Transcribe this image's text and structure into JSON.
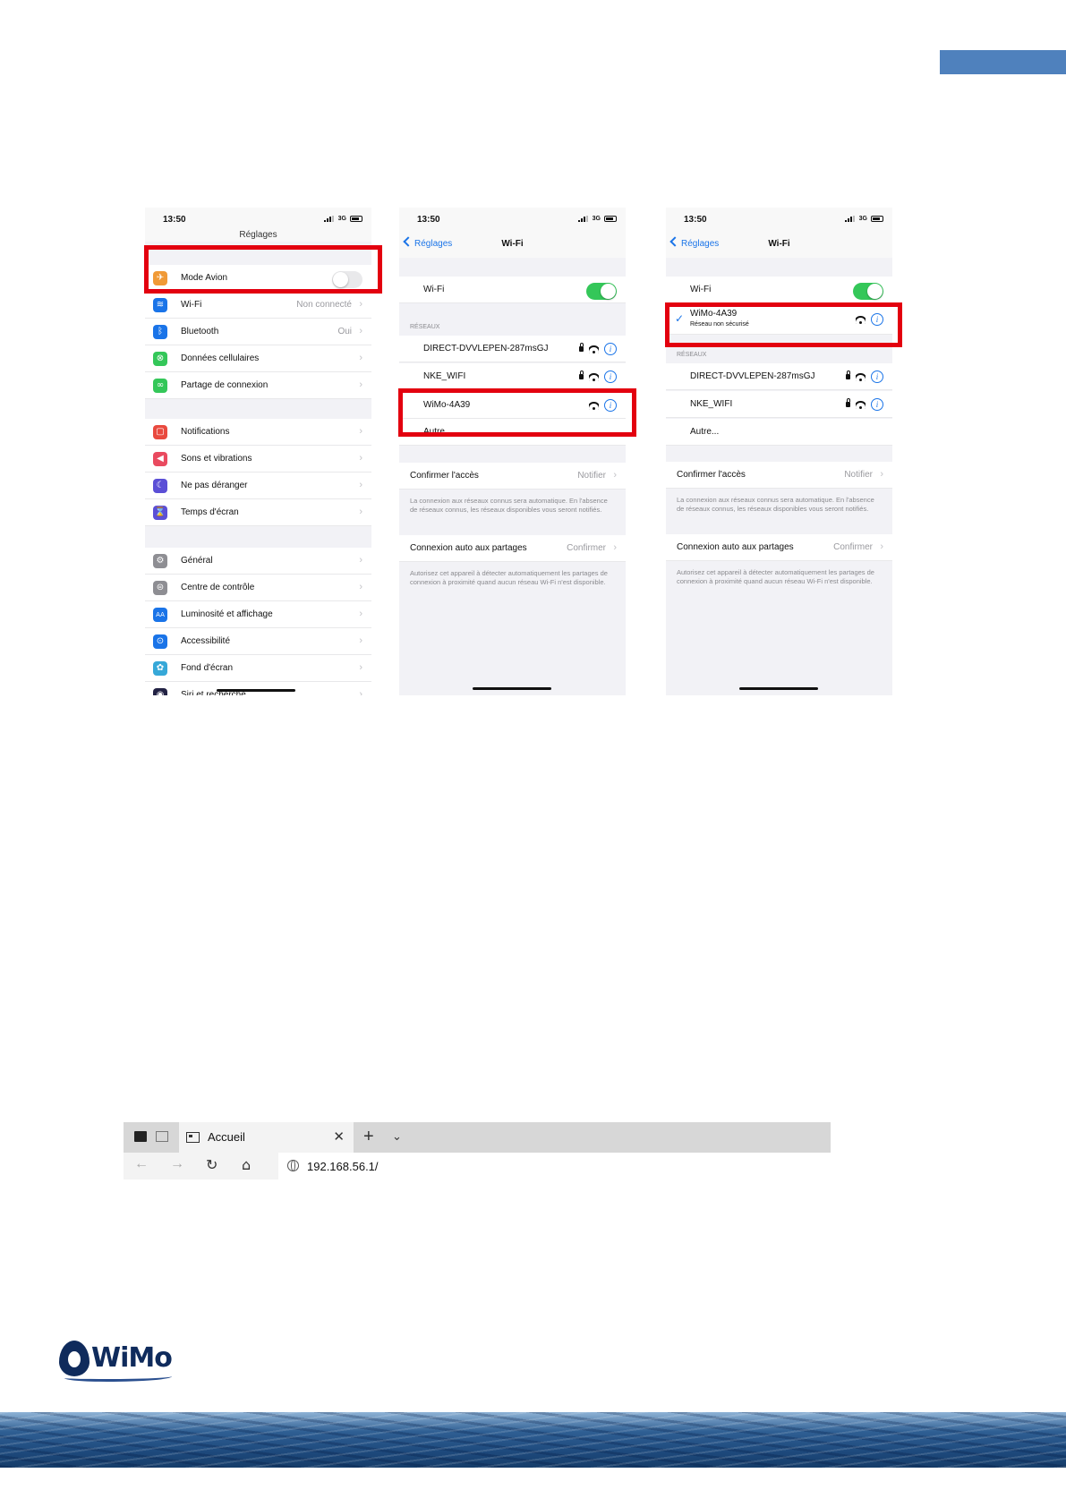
{
  "colors": {
    "accent_blue": "#4f81bd",
    "highlight_red": "#e3000f",
    "ios_blue": "#1a74e8",
    "ios_green": "#34c759",
    "brand_navy": "#0f2b5c"
  },
  "phone1": {
    "time": "13:50",
    "network": "3G",
    "title": "Réglages",
    "rows": [
      {
        "label": "Mode Avion",
        "value": "",
        "icon": "airplane-icon",
        "color": "#f09a37"
      },
      {
        "label": "Wi-Fi",
        "value": "Non connecté",
        "icon": "wifi-icon",
        "color": "#1a74e8"
      },
      {
        "label": "Bluetooth",
        "value": "Oui",
        "icon": "bluetooth-icon",
        "color": "#1a74e8"
      },
      {
        "label": "Données cellulaires",
        "value": "",
        "icon": "antenna-icon",
        "color": "#34c759"
      },
      {
        "label": "Partage de connexion",
        "value": "",
        "icon": "link-icon",
        "color": "#34c759"
      },
      {
        "label": "Notifications",
        "value": "",
        "icon": "notification-icon",
        "color": "#e94a3f"
      },
      {
        "label": "Sons et vibrations",
        "value": "",
        "icon": "speaker-icon",
        "color": "#e94a5f"
      },
      {
        "label": "Ne pas déranger",
        "value": "",
        "icon": "moon-icon",
        "color": "#5b4fd6"
      },
      {
        "label": "Temps d'écran",
        "value": "",
        "icon": "hourglass-icon",
        "color": "#5b4fd6"
      },
      {
        "label": "Général",
        "value": "",
        "icon": "gear-icon",
        "color": "#8e8e93"
      },
      {
        "label": "Centre de contrôle",
        "value": "",
        "icon": "switches-icon",
        "color": "#8e8e93"
      },
      {
        "label": "Luminosité et affichage",
        "value": "",
        "icon": "text-size-icon",
        "color": "#1a74e8"
      },
      {
        "label": "Accessibilité",
        "value": "",
        "icon": "accessibility-icon",
        "color": "#1a74e8"
      },
      {
        "label": "Fond d'écran",
        "value": "",
        "icon": "flower-icon",
        "color": "#36a8d8"
      },
      {
        "label": "Siri et recherche",
        "value": "",
        "icon": "siri-icon",
        "color": "#222244"
      }
    ]
  },
  "phone2": {
    "time": "13:50",
    "network": "3G",
    "back": "Réglages",
    "title": "Wi-Fi",
    "wifi_label": "Wi-Fi",
    "section": "RÉSEAUX",
    "networks": [
      "DIRECT-DVVLEPEN-287msGJ",
      "NKE_WIFI",
      "WiMo-4A39"
    ],
    "other": "Autre...",
    "confirm_label": "Confirmer l'accès",
    "confirm_value": "Notifier",
    "confirm_note": "La connexion aux réseaux connus sera automatique. En l'absence de réseaux connus, les réseaux disponibles vous seront notifiés.",
    "hotspot_label": "Connexion auto aux partages",
    "hotspot_value": "Confirmer",
    "hotspot_note": "Autorisez cet appareil à détecter automatiquement les partages de connexion à proximité quand aucun réseau Wi-Fi n'est disponible."
  },
  "phone3": {
    "time": "13:50",
    "network": "3G",
    "back": "Réglages",
    "title": "Wi-Fi",
    "wifi_label": "Wi-Fi",
    "connected_network": "WiMo-4A39",
    "connected_status": "Réseau non sécurisé",
    "section": "RÉSEAUX",
    "networks": [
      "DIRECT-DVVLEPEN-287msGJ",
      "NKE_WIFI"
    ],
    "other": "Autre...",
    "confirm_label": "Confirmer l'accès",
    "confirm_value": "Notifier",
    "confirm_note": "La connexion aux réseaux connus sera automatique. En l'absence de réseaux connus, les réseaux disponibles vous seront notifiés.",
    "hotspot_label": "Connexion auto aux partages",
    "hotspot_value": "Confirmer",
    "hotspot_note": "Autorisez cet appareil à détecter automatiquement les partages de connexion à proximité quand aucun réseau Wi-Fi n'est disponible."
  },
  "browser": {
    "tab_title": "Accueil",
    "url": "192.168.56.1/"
  },
  "logo": {
    "text": "WiMo"
  }
}
